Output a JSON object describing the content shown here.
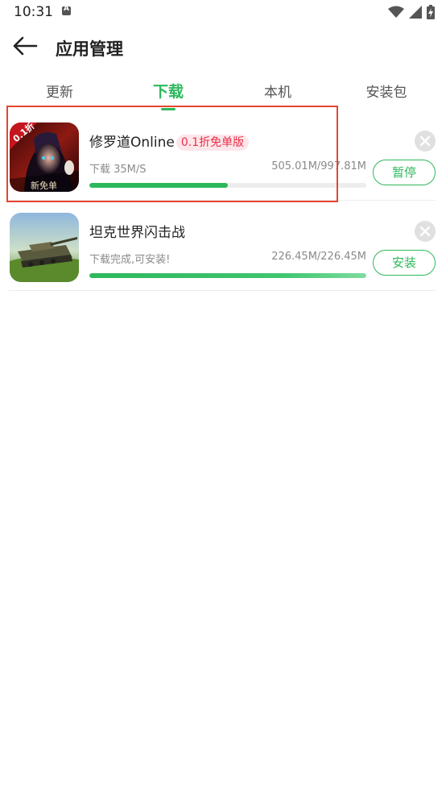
{
  "status_bar": {
    "time": "10:31",
    "icons": [
      "accessibility-a-icon",
      "wifi-icon",
      "signal-icon",
      "battery-charging-icon"
    ]
  },
  "header": {
    "title": "应用管理",
    "back_icon": "back-arrow-icon"
  },
  "tabs": [
    {
      "label": "更新",
      "active": false
    },
    {
      "label": "下载",
      "active": true
    },
    {
      "label": "本机",
      "active": false
    },
    {
      "label": "安装包",
      "active": false
    }
  ],
  "downloads": [
    {
      "name": "修罗道Online",
      "tag": "0.1折免单版",
      "status": "下载 35M/S",
      "size": "505.01M/997.81M",
      "progress": 0.5,
      "action_label": "暂停",
      "icon_badge": "0.1折",
      "icon_caption": "新免单"
    },
    {
      "name": "坦克世界闪击战",
      "tag": "",
      "status": "下载完成,可安装!",
      "size": "226.45M/226.45M",
      "progress": 1.0,
      "action_label": "安装"
    }
  ],
  "colors": {
    "accent": "#2eb85c",
    "tag_text": "#e8304a",
    "tag_bg": "#fde6ea",
    "highlight": "#e5452f"
  }
}
